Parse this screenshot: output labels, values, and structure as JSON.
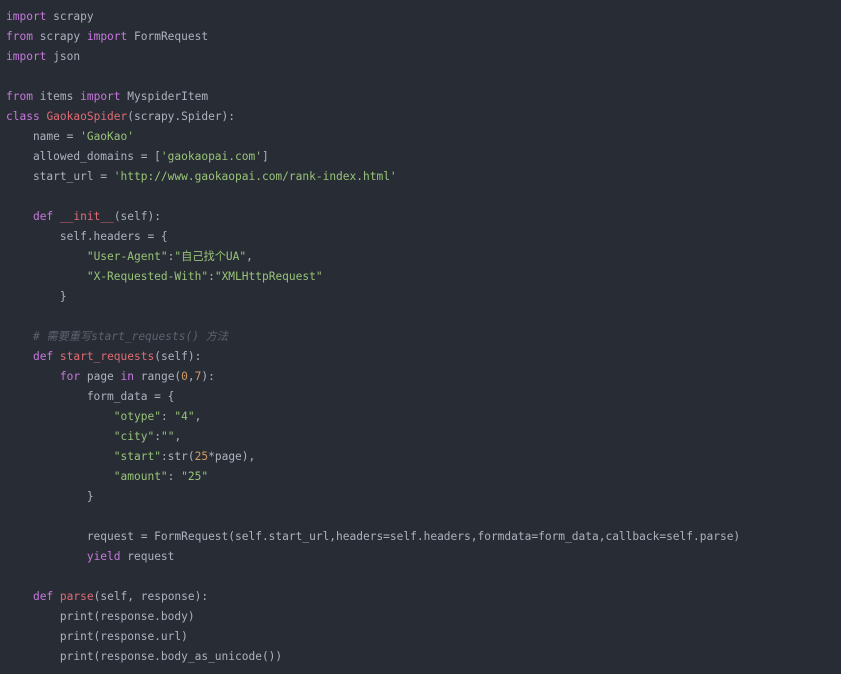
{
  "colors": {
    "background": "#282c34",
    "plain": "#abb2bf",
    "keyword": "#c678dd",
    "string": "#98c379",
    "function": "#e06c75",
    "number": "#d19a66",
    "comment": "#5c6370"
  },
  "code": {
    "language": "python",
    "lines": [
      [
        [
          "keyword",
          "import"
        ],
        [
          "plain",
          " scrapy"
        ]
      ],
      [
        [
          "keyword",
          "from"
        ],
        [
          "plain",
          " scrapy "
        ],
        [
          "keyword",
          "import"
        ],
        [
          "plain",
          " FormRequest"
        ]
      ],
      [
        [
          "keyword",
          "import"
        ],
        [
          "plain",
          " json"
        ]
      ],
      [],
      [
        [
          "keyword",
          "from"
        ],
        [
          "plain",
          " items "
        ],
        [
          "keyword",
          "import"
        ],
        [
          "plain",
          " MyspiderItem"
        ]
      ],
      [
        [
          "keyword",
          "class"
        ],
        [
          "plain",
          " "
        ],
        [
          "function",
          "GaokaoSpider"
        ],
        [
          "plain",
          "(scrapy.Spider):"
        ]
      ],
      [
        [
          "plain",
          "    name = "
        ],
        [
          "string",
          "'GaoKao'"
        ]
      ],
      [
        [
          "plain",
          "    allowed_domains = ["
        ],
        [
          "string",
          "'gaokaopai.com'"
        ],
        [
          "plain",
          "]"
        ]
      ],
      [
        [
          "plain",
          "    start_url = "
        ],
        [
          "string",
          "'http://www.gaokaopai.com/rank-index.html'"
        ]
      ],
      [],
      [
        [
          "plain",
          "    "
        ],
        [
          "keyword",
          "def"
        ],
        [
          "plain",
          " "
        ],
        [
          "function",
          "__init__"
        ],
        [
          "plain",
          "(self):"
        ]
      ],
      [
        [
          "plain",
          "        self.headers = {"
        ]
      ],
      [
        [
          "plain",
          "            "
        ],
        [
          "string",
          "\"User-Agent\""
        ],
        [
          "plain",
          ":"
        ],
        [
          "string",
          "\"自己找个UA\""
        ],
        [
          "plain",
          ","
        ]
      ],
      [
        [
          "plain",
          "            "
        ],
        [
          "string",
          "\"X-Requested-With\""
        ],
        [
          "plain",
          ":"
        ],
        [
          "string",
          "\"XMLHttpRequest\""
        ]
      ],
      [
        [
          "plain",
          "        }"
        ]
      ],
      [],
      [
        [
          "plain",
          "    "
        ],
        [
          "comment",
          "# 需要重写start_requests() 方法"
        ]
      ],
      [
        [
          "plain",
          "    "
        ],
        [
          "keyword",
          "def"
        ],
        [
          "plain",
          " "
        ],
        [
          "function",
          "start_requests"
        ],
        [
          "plain",
          "(self):"
        ]
      ],
      [
        [
          "plain",
          "        "
        ],
        [
          "keyword",
          "for"
        ],
        [
          "plain",
          " page "
        ],
        [
          "keyword",
          "in"
        ],
        [
          "plain",
          " range("
        ],
        [
          "number",
          "0"
        ],
        [
          "plain",
          ","
        ],
        [
          "number",
          "7"
        ],
        [
          "plain",
          "):"
        ]
      ],
      [
        [
          "plain",
          "            form_data = {"
        ]
      ],
      [
        [
          "plain",
          "                "
        ],
        [
          "string",
          "\"otype\""
        ],
        [
          "plain",
          ": "
        ],
        [
          "string",
          "\"4\""
        ],
        [
          "plain",
          ","
        ]
      ],
      [
        [
          "plain",
          "                "
        ],
        [
          "string",
          "\"city\""
        ],
        [
          "plain",
          ":"
        ],
        [
          "string",
          "\"\""
        ],
        [
          "plain",
          ","
        ]
      ],
      [
        [
          "plain",
          "                "
        ],
        [
          "string",
          "\"start\""
        ],
        [
          "plain",
          ":str("
        ],
        [
          "number",
          "25"
        ],
        [
          "plain",
          "*page),"
        ]
      ],
      [
        [
          "plain",
          "                "
        ],
        [
          "string",
          "\"amount\""
        ],
        [
          "plain",
          ": "
        ],
        [
          "string",
          "\"25\""
        ]
      ],
      [
        [
          "plain",
          "            }"
        ]
      ],
      [],
      [
        [
          "plain",
          "            request = FormRequest(self.start_url,headers=self.headers,formdata=form_data,callback=self.parse)"
        ]
      ],
      [
        [
          "plain",
          "            "
        ],
        [
          "keyword",
          "yield"
        ],
        [
          "plain",
          " request"
        ]
      ],
      [],
      [
        [
          "plain",
          "    "
        ],
        [
          "keyword",
          "def"
        ],
        [
          "plain",
          " "
        ],
        [
          "function",
          "parse"
        ],
        [
          "plain",
          "(self, response):"
        ]
      ],
      [
        [
          "plain",
          "        print(response.body)"
        ]
      ],
      [
        [
          "plain",
          "        print(response.url)"
        ]
      ],
      [
        [
          "plain",
          "        print(response.body_as_unicode())"
        ]
      ]
    ]
  }
}
